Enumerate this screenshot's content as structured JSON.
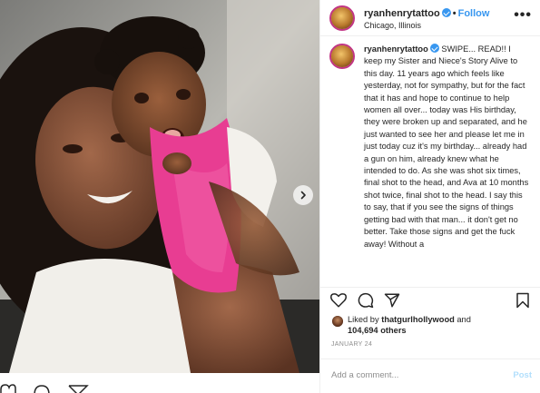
{
  "post": {
    "username": "ryanhenrytattoo",
    "follow_label": "Follow",
    "separator": "•",
    "location": "Chicago, Illinois",
    "more_label": "•••",
    "caption_username": "ryanhenrytattoo",
    "caption_text": "SWIPE... READ!! I keep my Sister and Niece's Story Alive to this day. 11 years ago which feels like yesterday, not for sympathy, but for the fact that it has and hope to continue to help women all over... today was His birthday, they were broken up and separated, and he just wanted to see her and please let me in just today cuz it's my birthday... already had a gun on him, already knew what he intended to do. As she was shot six times, final shot to the head, and Ava at 10 months shot twice, final shot to the head. I say this to say, that if you see the signs of things getting bad with that man... it don't get no better. Take those signs and get the fuck away! Without a",
    "liked_by_prefix": "Liked by",
    "liked_by_user": "thatgurlhollywood",
    "liked_by_and": "and",
    "likes_count": "104,694 others",
    "date": "JANUARY 24",
    "comment_placeholder": "Add a comment...",
    "post_label": "Post"
  },
  "colors": {
    "accent": "#3897f0",
    "post_disabled": "#b2dffc",
    "muted": "#8e8e8e",
    "text": "#262626"
  },
  "icons": {
    "heart": "heart-icon",
    "comment": "comment-icon",
    "share": "share-icon",
    "save": "bookmark-icon",
    "next": "chevron-right-icon",
    "more": "more-options-icon"
  }
}
